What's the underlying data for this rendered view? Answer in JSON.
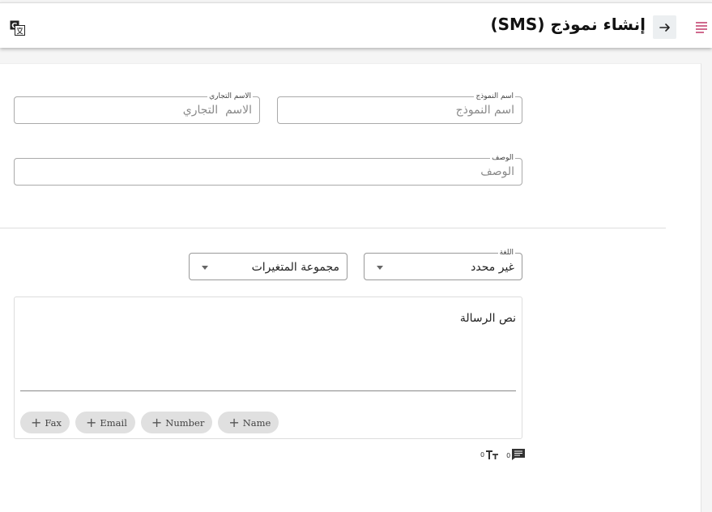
{
  "header": {
    "title": "إنشاء نموذج (SMS)",
    "menu_icon": "menu-icon",
    "back_icon": "arrow-right-icon",
    "translate_icon": "translate-icon"
  },
  "form": {
    "template_name": {
      "label": "اسم النموذج",
      "placeholder": "اسم النموذج",
      "value": ""
    },
    "brand_name": {
      "label": "الاسم التجاري",
      "placeholder": "الاسم  التجاري",
      "value": ""
    },
    "description": {
      "label": "الوصف",
      "placeholder": "الوصف",
      "value": ""
    },
    "language": {
      "label": "اللغة",
      "value": "غير محدد"
    },
    "variable_group": {
      "value": "مجموعة المتغيرات"
    }
  },
  "message": {
    "label": "نص الرسالة",
    "chips": [
      {
        "label": "Name"
      },
      {
        "label": "Number"
      },
      {
        "label": "Email"
      },
      {
        "label": "Fax"
      }
    ]
  },
  "counters": {
    "messages": "0",
    "characters": "0"
  },
  "colors": {
    "accent": "#d06a8e",
    "chip_bg": "#e0e0e0"
  }
}
